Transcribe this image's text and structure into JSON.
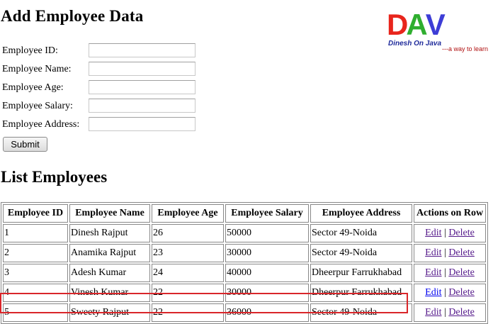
{
  "add_section": {
    "title": "Add Employee Data",
    "fields": [
      {
        "label": "Employee ID:",
        "value": ""
      },
      {
        "label": "Employee Name:",
        "value": ""
      },
      {
        "label": "Employee Age:",
        "value": ""
      },
      {
        "label": "Employee Salary:",
        "value": ""
      },
      {
        "label": "Employee Address:",
        "value": ""
      }
    ],
    "submit_label": "Submit"
  },
  "logo": {
    "letters": [
      "D",
      "A",
      "V"
    ],
    "name": "Dinesh On Java",
    "tagline": "---a way to learn"
  },
  "list_section": {
    "title": "List Employees",
    "columns": [
      "Employee ID",
      "Employee Name",
      "Employee Age",
      "Employee Salary",
      "Employee Address",
      "Actions on Row"
    ],
    "rows": [
      {
        "id": "1",
        "name": "Dinesh Rajput",
        "age": "26",
        "salary": "50000",
        "address": "Sector 49-Noida"
      },
      {
        "id": "2",
        "name": "Anamika Rajput",
        "age": "23",
        "salary": "30000",
        "address": "Sector 49-Noida"
      },
      {
        "id": "3",
        "name": "Adesh Kumar",
        "age": "24",
        "salary": "40000",
        "address": "Dheerpur Farrukhabad"
      },
      {
        "id": "4",
        "name": "Vinesh Kumar",
        "age": "22",
        "salary": "30000",
        "address": "Dheerpur Farrukhabad"
      },
      {
        "id": "5",
        "name": "Sweety Rajput",
        "age": "22",
        "salary": "36000",
        "address": "Sector 49-Noida"
      }
    ],
    "edit_label": "Edit",
    "separator": "|",
    "delete_label": "Delete"
  },
  "colors": {
    "link_visited": "#551a8b",
    "link_unvisited": "#0000ee",
    "highlight": "#d9262a"
  }
}
